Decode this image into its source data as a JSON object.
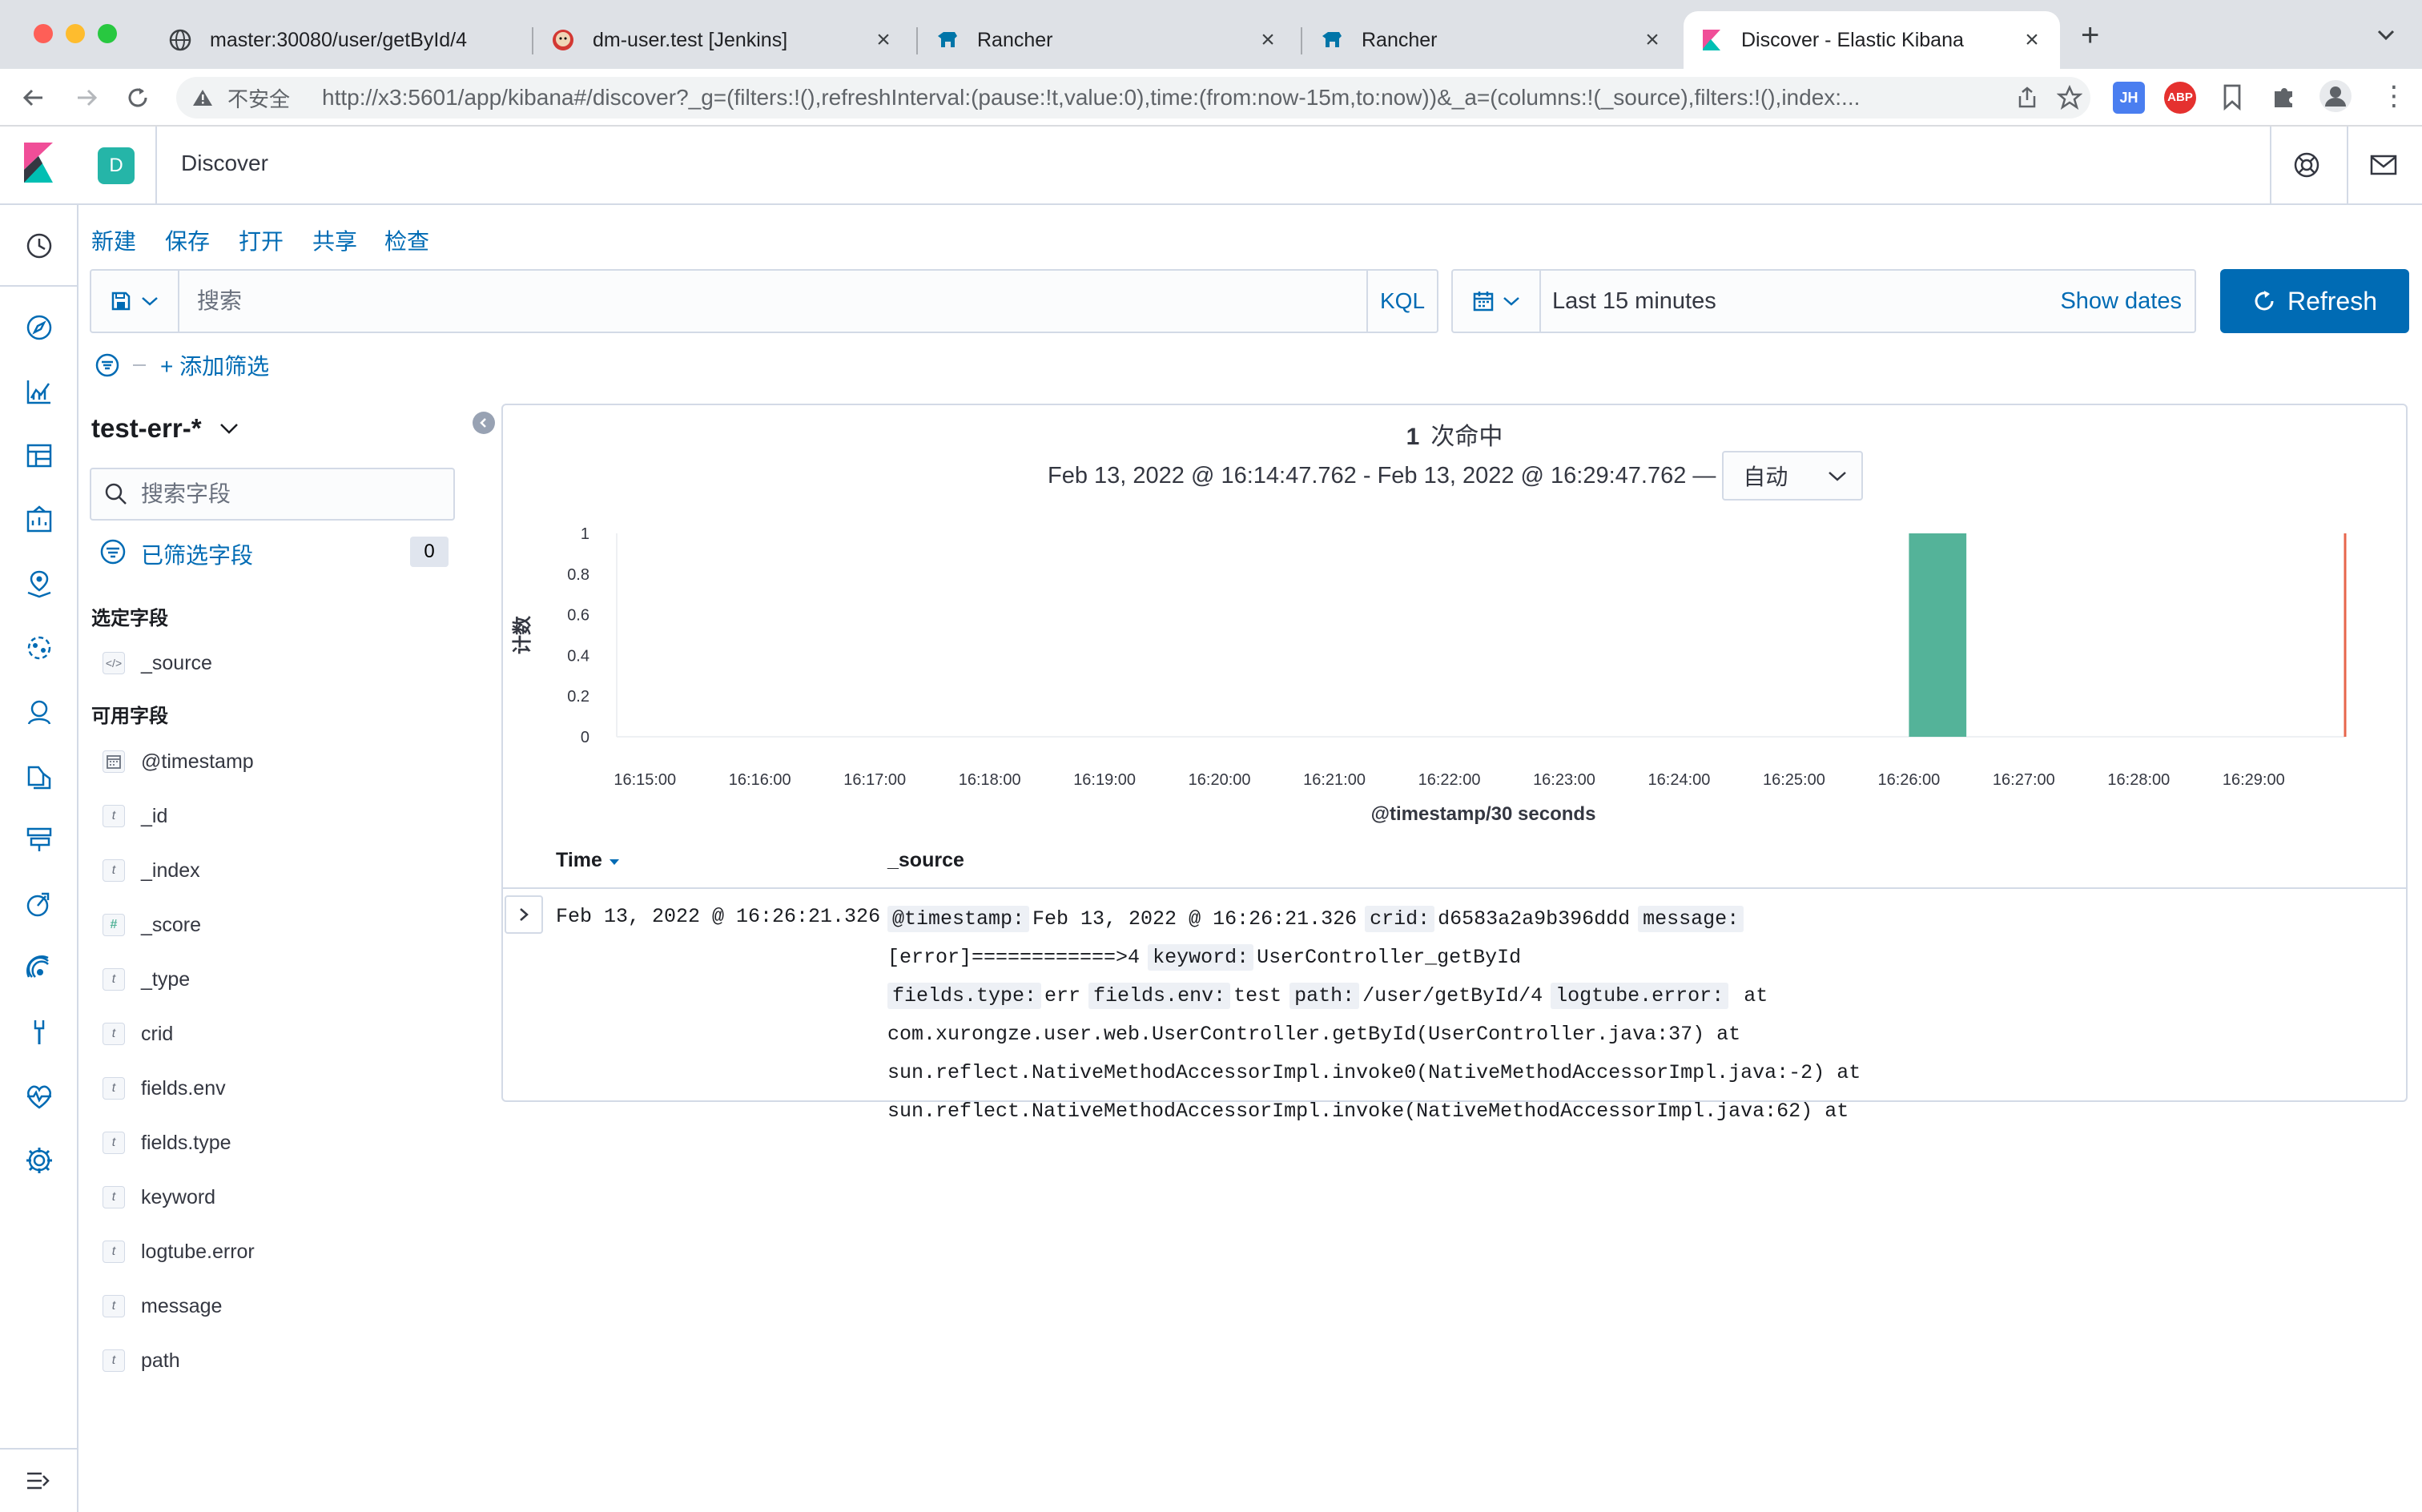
{
  "browser": {
    "tabs": [
      {
        "title": "master:30080/user/getById/4",
        "icon": "globe-icon"
      },
      {
        "title": "dm-user.test [Jenkins]",
        "icon": "jenkins-icon"
      },
      {
        "title": "Rancher",
        "icon": "rancher-icon"
      },
      {
        "title": "Rancher",
        "icon": "rancher-icon"
      },
      {
        "title": "Discover - Elastic Kibana",
        "icon": "kibana-icon",
        "active": true
      }
    ],
    "insecure_label": "不安全",
    "url": "http://x3:5601/app/kibana#/discover?_g=(filters:!(),refreshInterval:(pause:!t,value:0),time:(from:now-15m,to:now))&_a=(columns:!(_source),filters:!(),index:...",
    "extensions": [
      "JH",
      "ABP"
    ]
  },
  "header": {
    "space_initial": "D",
    "title": "Discover"
  },
  "topmenu": {
    "new": "新建",
    "save": "保存",
    "open": "打开",
    "share": "共享",
    "inspect": "检查"
  },
  "query": {
    "placeholder": "搜索",
    "language": "KQL"
  },
  "timepicker": {
    "range": "Last 15 minutes",
    "show_dates": "Show dates",
    "refresh": "Refresh"
  },
  "filters": {
    "add_label": "+ 添加筛选"
  },
  "sidebar": {
    "index_pattern": "test-err-*",
    "search_placeholder": "搜索字段",
    "filtered_label": "已筛选字段",
    "filtered_count": "0",
    "selected_title": "选定字段",
    "selected_fields": [
      {
        "name": "_source",
        "type": "</>"
      }
    ],
    "available_title": "可用字段",
    "available_fields": [
      {
        "name": "@timestamp",
        "type": "date"
      },
      {
        "name": "_id",
        "type": "t"
      },
      {
        "name": "_index",
        "type": "t"
      },
      {
        "name": "_score",
        "type": "#"
      },
      {
        "name": "_type",
        "type": "t"
      },
      {
        "name": "crid",
        "type": "t"
      },
      {
        "name": "fields.env",
        "type": "t"
      },
      {
        "name": "fields.type",
        "type": "t"
      },
      {
        "name": "keyword",
        "type": "t"
      },
      {
        "name": "logtube.error",
        "type": "t"
      },
      {
        "name": "message",
        "type": "t"
      },
      {
        "name": "path",
        "type": "t"
      }
    ]
  },
  "results": {
    "hits_count": "1",
    "hits_label": "次命中",
    "time_range": "Feb 13, 2022 @ 16:14:47.762 - Feb 13, 2022 @ 16:29:47.762 —",
    "interval": "自动",
    "columns": {
      "time": "Time",
      "source": "_source"
    },
    "rows": [
      {
        "time": "Feb 13, 2022 @ 16:26:21.326",
        "lines": [
          [
            [
              "@timestamp:",
              "Feb 13, 2022 @ 16:26:21.326"
            ],
            [
              "crid:",
              "d6583a2a9b396ddd"
            ],
            [
              "message:",
              " [error]============>4"
            ],
            [
              "keyword:",
              "UserController_getById"
            ]
          ],
          [
            [
              "fields.type:",
              "err"
            ],
            [
              "fields.env:",
              "test"
            ],
            [
              "path:",
              "/user/getById/4"
            ],
            [
              "logtube.error:",
              " at"
            ]
          ],
          [
            [
              "",
              "com.xurongze.user.web.UserController.getById(UserController.java:37) at"
            ]
          ],
          [
            [
              "",
              "sun.reflect.NativeMethodAccessorImpl.invoke0(NativeMethodAccessorImpl.java:-2) at"
            ]
          ],
          [
            [
              "",
              "sun.reflect.NativeMethodAccessorImpl.invoke(NativeMethodAccessorImpl.java:62) at"
            ]
          ]
        ]
      }
    ]
  },
  "chart_data": {
    "type": "bar",
    "x": [
      "16:15:00",
      "16:16:00",
      "16:17:00",
      "16:18:00",
      "16:19:00",
      "16:20:00",
      "16:21:00",
      "16:22:00",
      "16:23:00",
      "16:24:00",
      "16:25:00",
      "16:26:00",
      "16:27:00",
      "16:28:00",
      "16:29:00"
    ],
    "bars": [
      {
        "start": "16:26:00",
        "end": "16:26:30",
        "value": 1
      }
    ],
    "now_marker": "16:29:47.762",
    "ylabel": "计数",
    "xlabel": "@timestamp/30 seconds",
    "yticks": [
      0,
      0.2,
      0.4,
      0.6,
      0.8,
      1
    ],
    "ylim": [
      0,
      1
    ],
    "xlim": [
      "16:14:47.762",
      "16:29:47.762"
    ],
    "bar_color": "#54b399",
    "marker_color": "#e7664c",
    "grid": false
  }
}
